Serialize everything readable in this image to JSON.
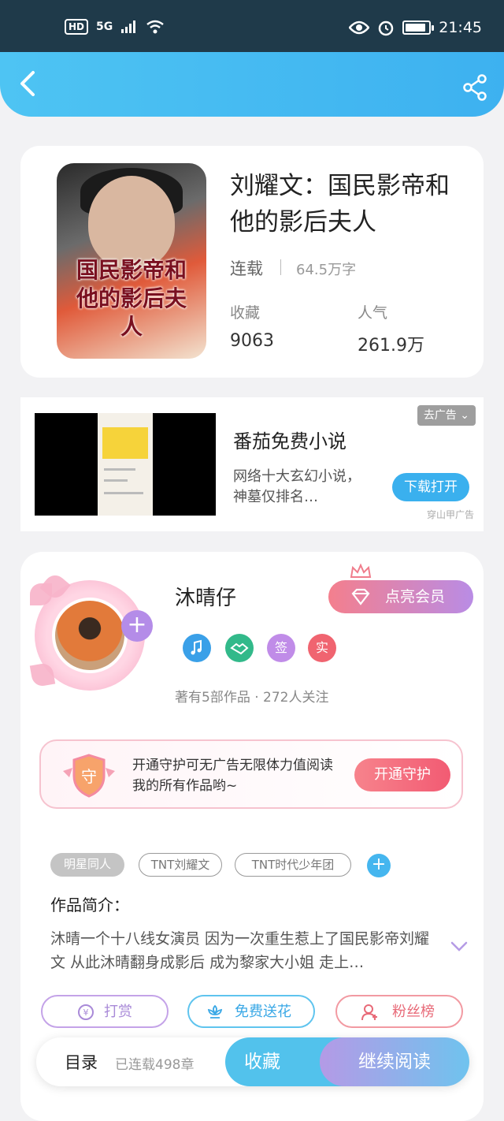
{
  "status_bar": {
    "hd": "HD",
    "network": "5G",
    "time": "21:45",
    "battery_level": 0.9
  },
  "book": {
    "title": "刘耀文：国民影帝和他的影后夫人",
    "status": "连载",
    "word_count": "64.5万字",
    "collect_label": "收藏",
    "collect_value": "9063",
    "popularity_label": "人气",
    "popularity_value": "261.9万",
    "cover_title": "国民影帝和他的影后夫人"
  },
  "ad": {
    "remove_label": "去广告",
    "title": "番茄免费小说",
    "description": "网络十大玄幻小说，神墓仅排名…",
    "download_label": "下载打开",
    "source": "穿山甲广告"
  },
  "author": {
    "name": "沐晴仔",
    "vip_label": "点亮会员",
    "badges": [
      {
        "name": "music-badge-icon",
        "text": "",
        "color": "#3aa0e8"
      },
      {
        "name": "handshake-badge-icon",
        "text": "",
        "color": "#32b98a"
      },
      {
        "name": "sign-badge",
        "text": "签",
        "color": "#c08ce8"
      },
      {
        "name": "real-name-badge",
        "text": "实",
        "color": "#f06470"
      }
    ],
    "meta": "著有5部作品 · 272人关注"
  },
  "guard": {
    "text": "开通守护可无广告无限体力值阅读我的所有作品哟~",
    "shield_char": "守",
    "button_label": "开通守护"
  },
  "tags": [
    "明星同人",
    "TNT刘耀文",
    "TNT时代少年团"
  ],
  "intro": {
    "label": "作品简介：",
    "text": "沐晴一个十八线女演员 因为一次重生惹上了国民影帝刘耀文 从此沐晴翻身成影后 成为黎家大小姐 走上…"
  },
  "actions": {
    "reward_label": "打赏",
    "flower_label": "免费送花",
    "fans_label": "粉丝榜"
  },
  "bottom": {
    "toc_label": "目录",
    "chapter_count": "已连载498章",
    "collect_label": "收藏",
    "read_label": "继续阅读"
  }
}
